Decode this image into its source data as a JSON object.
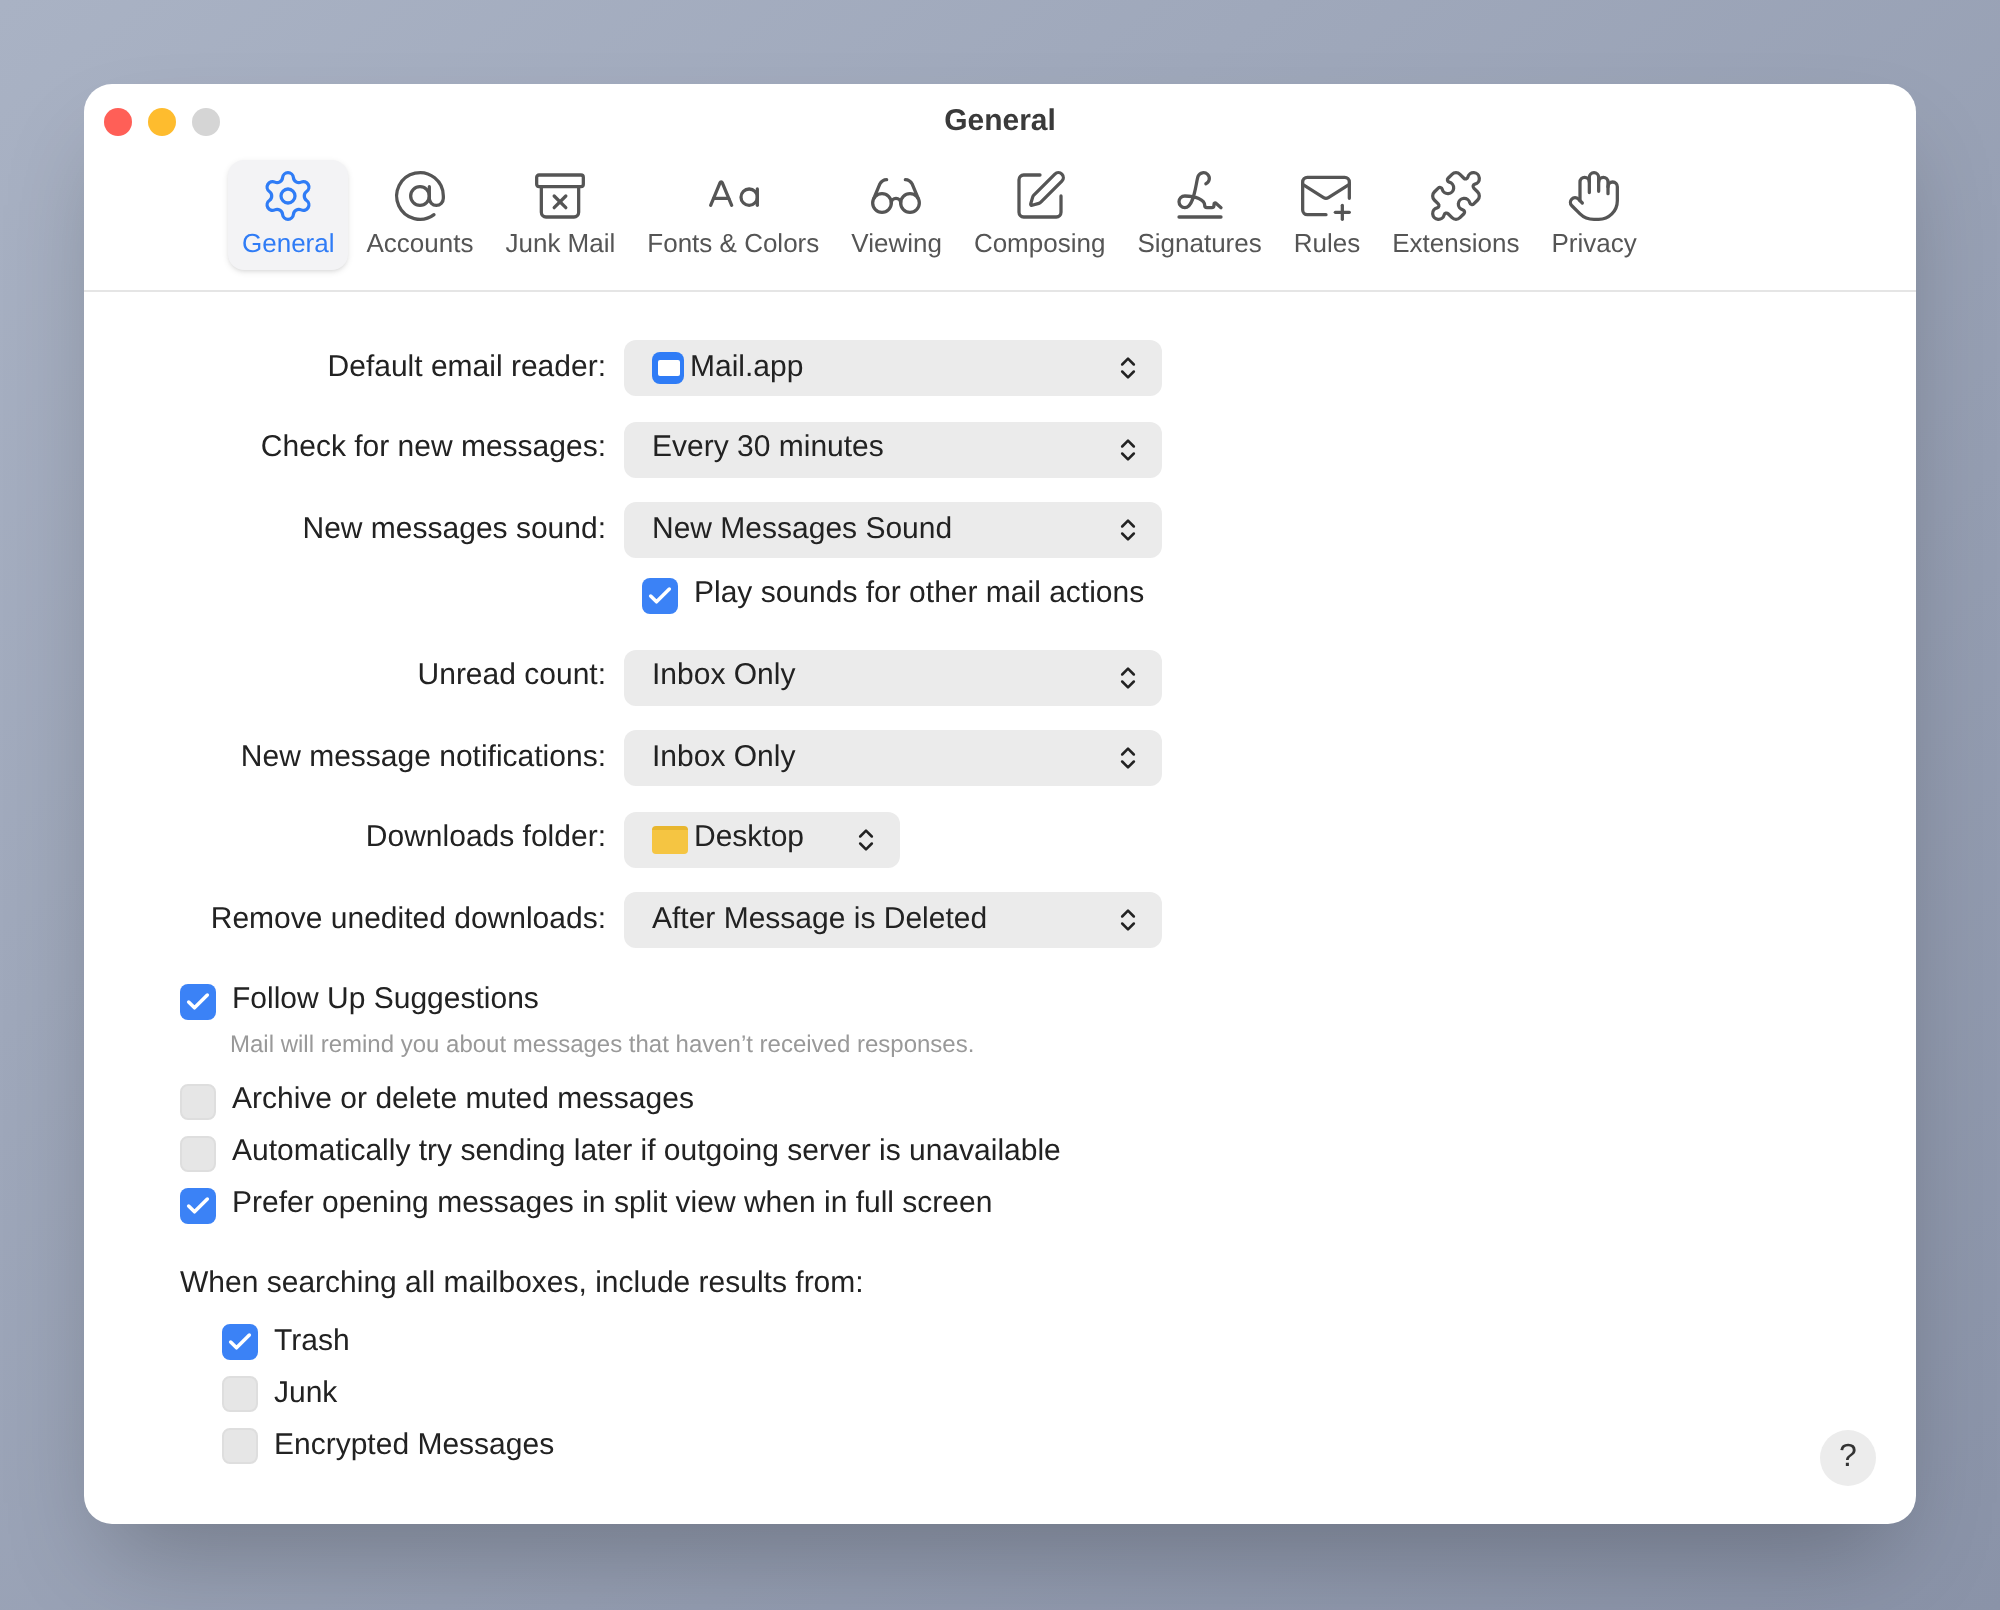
{
  "window": {
    "title": "General"
  },
  "toolbar": [
    {
      "label": "General",
      "selected": true
    },
    {
      "label": "Accounts",
      "selected": false
    },
    {
      "label": "Junk Mail",
      "selected": false
    },
    {
      "label": "Fonts & Colors",
      "selected": false
    },
    {
      "label": "Viewing",
      "selected": false
    },
    {
      "label": "Composing",
      "selected": false
    },
    {
      "label": "Signatures",
      "selected": false
    },
    {
      "label": "Rules",
      "selected": false
    },
    {
      "label": "Extensions",
      "selected": false
    },
    {
      "label": "Privacy",
      "selected": false
    }
  ],
  "settings": [
    {
      "kind": "app",
      "label": "Default email reader:",
      "value": "Mail.app"
    },
    {
      "kind": "popup",
      "label": "Check for new messages:",
      "value": "Every 30 minutes"
    },
    {
      "kind": "popup",
      "label": "New messages sound:",
      "value": "New Messages Sound"
    },
    {
      "kind": "checkbox",
      "label": "Play sounds for other mail actions",
      "checked": true
    },
    {
      "kind": "popup",
      "label": "Unread count:",
      "value": "Inbox Only"
    },
    {
      "kind": "popup",
      "label": "New message notifications:",
      "value": "Inbox Only"
    },
    {
      "kind": "folder",
      "label": "Downloads folder:",
      "value": "Desktop"
    },
    {
      "kind": "popup",
      "label": "Remove unedited downloads:",
      "value": "After Message is Deleted"
    }
  ],
  "options": [
    {
      "label": "Follow Up Suggestions",
      "checked": true,
      "note": "Mail will remind you about messages that haven’t received responses."
    },
    {
      "label": "Archive or delete muted messages",
      "checked": false
    },
    {
      "label": "Automatically try sending later if outgoing server is unavailable",
      "checked": false
    },
    {
      "label": "Prefer opening messages in split view when in full screen",
      "checked": true
    }
  ],
  "search_scope": {
    "heading": "When searching all mailboxes, include results from:",
    "items": [
      {
        "label": "Trash",
        "checked": true
      },
      {
        "label": "Junk",
        "checked": false
      },
      {
        "label": "Encrypted Messages",
        "checked": false
      }
    ]
  },
  "help_button": "?"
}
